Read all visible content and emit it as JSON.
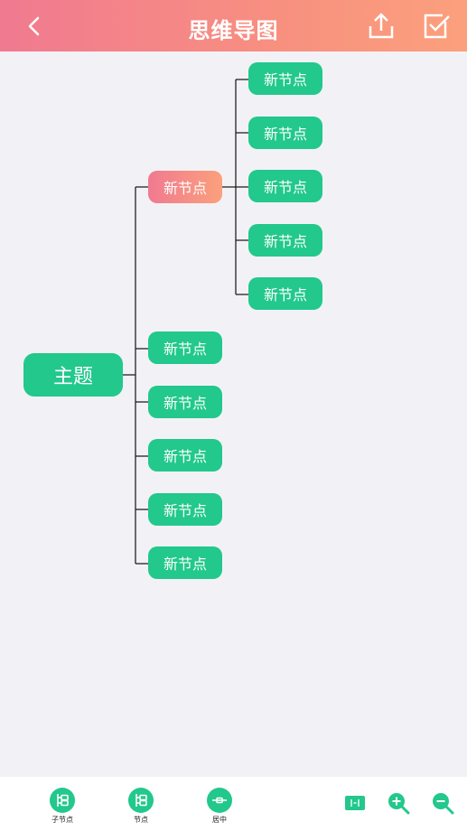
{
  "header": {
    "title": "思维导图"
  },
  "map": {
    "root": "主题",
    "child_selected": "新节点",
    "grandchildren": [
      "新节点",
      "新节点",
      "新节点",
      "新节点",
      "新节点"
    ],
    "children": [
      "新节点",
      "新节点",
      "新节点",
      "新节点",
      "新节点"
    ]
  },
  "toolbar": {
    "subnode_label": "子节点",
    "node_label": "节点",
    "center_label": "居中"
  },
  "icons": {
    "back": "back-arrow-icon",
    "share": "share-upload-icon",
    "confirm": "checkbox-icon",
    "fit": "fit-screen-icon",
    "zoom_in": "zoom-in-icon",
    "zoom_out": "zoom-out-icon"
  },
  "colors": {
    "accent": "#22c88c",
    "header_start": "#f07a90",
    "header_end": "#fba07c"
  }
}
